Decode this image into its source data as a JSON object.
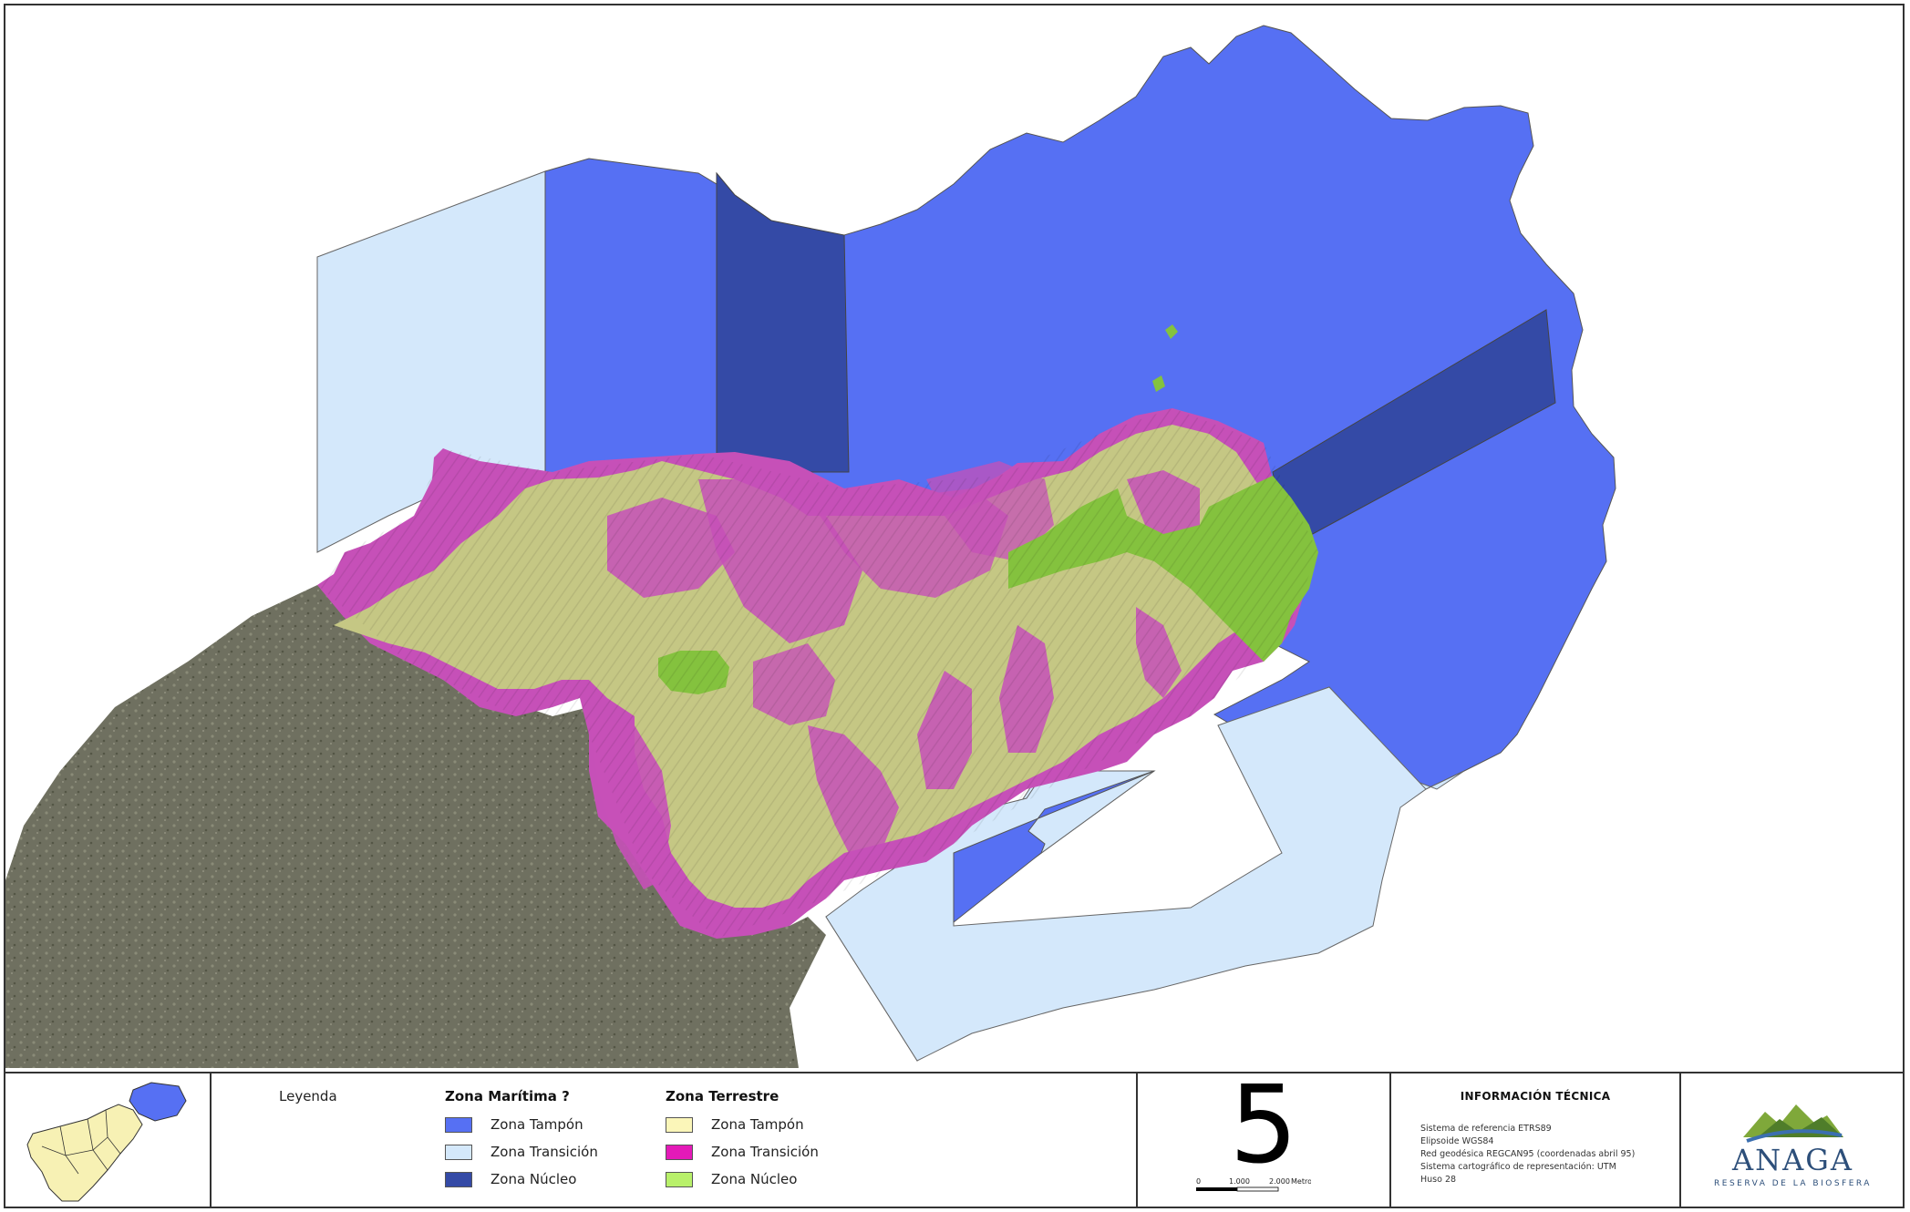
{
  "colors": {
    "maritime_buffer": "#5670f3",
    "maritime_transition": "#d4e8fb",
    "maritime_core": "#344aa6",
    "land_buffer": "#c5c784",
    "land_transition": "#c650b8",
    "land_core": "#84c23e",
    "surroundings": "#6f7060"
  },
  "legend": {
    "title": "Leyenda",
    "maritime": {
      "title": "Zona Marítima ?",
      "items": [
        {
          "label": "Zona Tampón",
          "color": "#5670f3"
        },
        {
          "label": "Zona Transición",
          "color": "#d4e8fb"
        },
        {
          "label": "Zona Núcleo",
          "color": "#344aa6"
        }
      ]
    },
    "terrestrial": {
      "title": "Zona Terrestre",
      "items": [
        {
          "label": "Zona Tampón",
          "color": "#fbf6b9"
        },
        {
          "label": "Zona Transición",
          "color": "#e41ab8"
        },
        {
          "label": "Zona Núcleo",
          "color": "#b8f06a"
        }
      ]
    }
  },
  "map_number": "5",
  "scale": {
    "ticks": [
      "0",
      "1.000",
      "2.000"
    ],
    "unit": "Metros"
  },
  "tech": {
    "title": "INFORMACIÓN TÉCNICA",
    "lines": [
      "Sistema de referencia ETRS89",
      "Elipsoide WGS84",
      "Red geodésica REGCAN95 (coordenadas abril 95)",
      "Sistema cartográfico de representación: UTM",
      "Huso 28"
    ]
  },
  "logo": {
    "name": "ANAGA",
    "subtitle": "RESERVA DE LA BIOSFERA"
  }
}
